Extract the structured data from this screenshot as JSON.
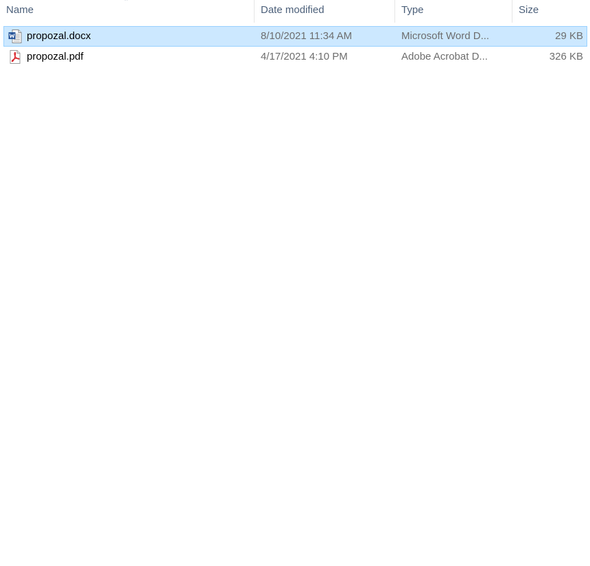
{
  "columns": {
    "name": "Name",
    "date_modified": "Date modified",
    "type": "Type",
    "size": "Size"
  },
  "files": [
    {
      "name": "propozal.docx",
      "date_modified": "8/10/2021 11:34 AM",
      "type": "Microsoft Word D...",
      "size": "29 KB",
      "icon": "word-document-icon",
      "selected": true
    },
    {
      "name": "propozal.pdf",
      "date_modified": "4/17/2021 4:10 PM",
      "type": "Adobe Acrobat D...",
      "size": "326 KB",
      "icon": "pdf-document-icon",
      "selected": false
    }
  ],
  "colors": {
    "selection_bg": "#cce8ff",
    "selection_border": "#99d1ff",
    "header_text": "#4c607a",
    "secondary_text": "#6d6d6d",
    "word_blue": "#2b579a",
    "pdf_red": "#d9262c"
  }
}
